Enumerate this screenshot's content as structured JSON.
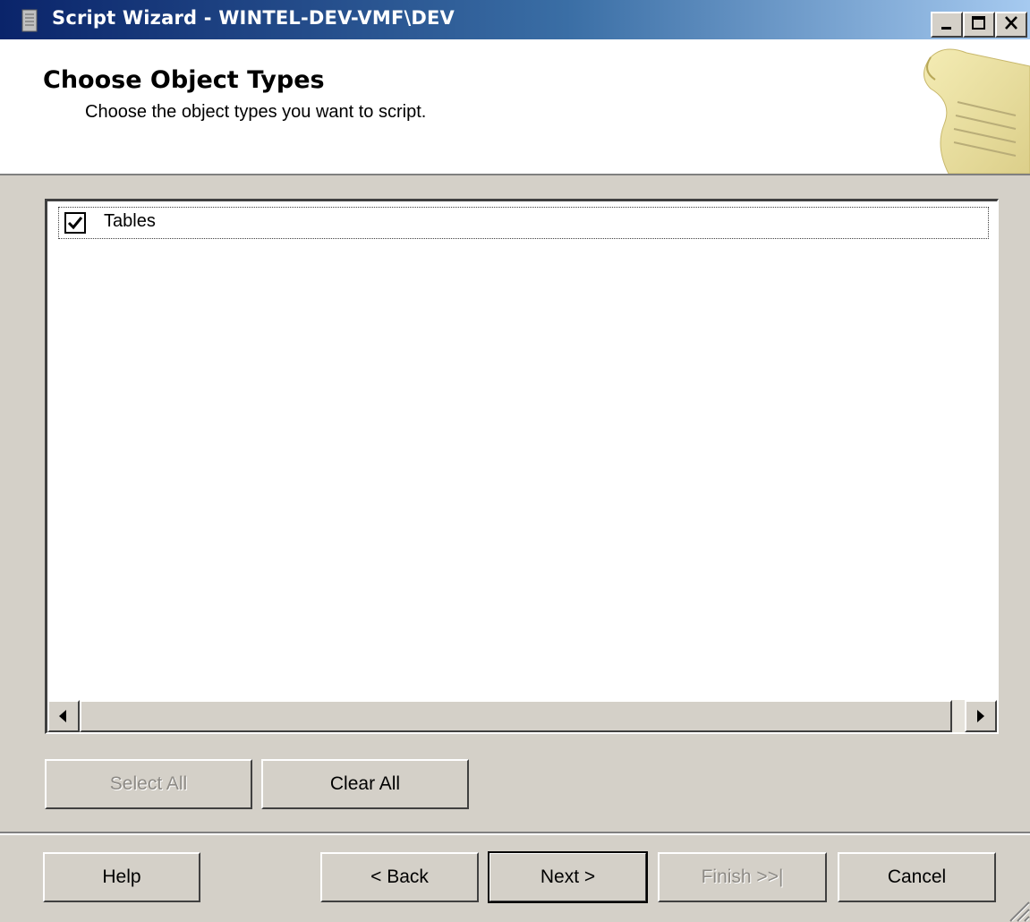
{
  "window": {
    "title": "Script Wizard - WINTEL-DEV-VMF\\DEV"
  },
  "header": {
    "title": "Choose Object Types",
    "subtitle": "Choose the object types you want to script."
  },
  "object_types": [
    {
      "label": "Tables",
      "checked": true
    }
  ],
  "buttons": {
    "select_all": "Select All",
    "clear_all": "Clear All",
    "help": "Help",
    "back": "< Back",
    "next": "Next >",
    "finish": "Finish >>|",
    "cancel": "Cancel"
  },
  "colors": {
    "titlebar_start": "#0a246a",
    "titlebar_end": "#a6caf0",
    "face": "#d4d0c8",
    "disabled_text": "#8d8a85"
  }
}
